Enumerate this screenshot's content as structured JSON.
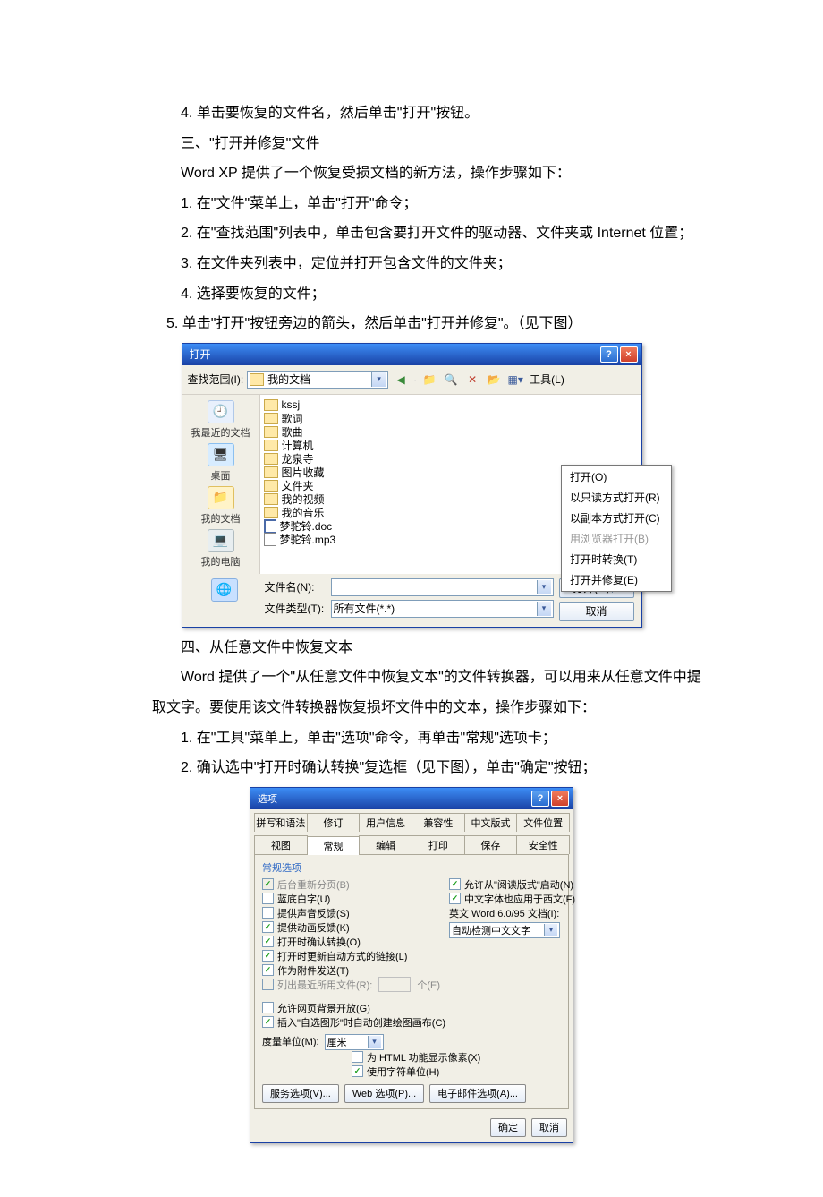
{
  "text": {
    "p1": "4. 单击要恢复的文件名，然后单击\"打开\"按钮。",
    "p2": "三、\"打开并修复\"文件",
    "p3": "Word XP 提供了一个恢复受损文档的新方法，操作步骤如下：",
    "p4": "1. 在\"文件\"菜单上，单击\"打开\"命令；",
    "p5": "2. 在\"查找范围\"列表中，单击包含要打开文件的驱动器、文件夹或 Internet 位置；",
    "p6": "3. 在文件夹列表中，定位并打开包含文件的文件夹；",
    "p7": "4. 选择要恢复的文件；",
    "p8": "5. 单击\"打开\"按钮旁边的箭头，然后单击\"打开并修复\"。（见下图）",
    "p9": "四、从任意文件中恢复文本",
    "p10": "Word 提供了一个\"从任意文件中恢复文本\"的文件转换器，可以用来从任意文件中提取文字。要使用该文件转换器恢复损坏文件中的文本，操作步骤如下：",
    "p11": "1. 在\"工具\"菜单上，单击\"选项\"命令，再单击\"常规\"选项卡；",
    "p12": "2. 确认选中\"打开时确认转换\"复选框（见下图），单击\"确定\"按钮；"
  },
  "dlg1": {
    "title": "打开",
    "lookInLabel": "查找范围(I):",
    "lookInValue": "我的文档",
    "toolsLabel": "工具(L)",
    "places": [
      {
        "label": "我最近的文档"
      },
      {
        "label": "桌面"
      },
      {
        "label": "我的文档"
      },
      {
        "label": "我的电脑"
      },
      {
        "label": ""
      }
    ],
    "files": [
      {
        "type": "f",
        "name": "kssj"
      },
      {
        "type": "f",
        "name": "歌词"
      },
      {
        "type": "f",
        "name": "歌曲"
      },
      {
        "type": "f",
        "name": "计算机"
      },
      {
        "type": "f",
        "name": "龙泉寺"
      },
      {
        "type": "f",
        "name": "图片收藏"
      },
      {
        "type": "f",
        "name": "文件夹"
      },
      {
        "type": "f",
        "name": "我的视频"
      },
      {
        "type": "f",
        "name": "我的音乐"
      },
      {
        "type": "d",
        "name": "梦驼铃.doc"
      },
      {
        "type": "m",
        "name": "梦驼铃.mp3"
      }
    ],
    "fileNameLabel": "文件名(N):",
    "fileTypeLabel": "文件类型(T):",
    "fileTypeValue": "所有文件(*.*)",
    "openBtn": "打开(O)",
    "cancelBtn": "取消",
    "menu": [
      {
        "t": "打开(O)",
        "dis": false
      },
      {
        "t": "以只读方式打开(R)",
        "dis": false
      },
      {
        "t": "以副本方式打开(C)",
        "dis": false
      },
      {
        "t": "用浏览器打开(B)",
        "dis": true
      },
      {
        "t": "打开时转换(T)",
        "dis": false
      },
      {
        "t": "打开并修复(E)",
        "dis": false
      }
    ]
  },
  "dlg2": {
    "title": "选项",
    "tabsRow1": [
      "拼写和语法",
      "修订",
      "用户信息",
      "兼容性",
      "中文版式",
      "文件位置"
    ],
    "tabsRow2": [
      "视图",
      "常规",
      "编辑",
      "打印",
      "保存",
      "安全性"
    ],
    "activeTab": "常规",
    "sectionLabel": "常规选项",
    "left": [
      {
        "label": "后台重新分页(B)",
        "checked": true,
        "disabled": true
      },
      {
        "label": "蓝底白字(U)",
        "checked": false
      },
      {
        "label": "提供声音反馈(S)",
        "checked": false
      },
      {
        "label": "提供动画反馈(K)",
        "checked": true
      },
      {
        "label": "打开时确认转换(O)",
        "checked": true
      },
      {
        "label": "打开时更新自动方式的链接(L)",
        "checked": true
      },
      {
        "label": "作为附件发送(T)",
        "checked": true
      }
    ],
    "recentLabel": "列出最近所用文件(R):",
    "recentUnit": "个(E)",
    "right": [
      {
        "label": "允许从\"阅读版式\"启动(N)",
        "checked": true
      },
      {
        "label": "中文字体也应用于西文(F)",
        "checked": true
      }
    ],
    "engLabel": "英文 Word 6.0/95 文档(I):",
    "engValue": "自动检测中文文字",
    "bottomChecks": [
      {
        "label": "允许网页背景开放(G)",
        "checked": false
      },
      {
        "label": "插入\"自选图形\"时自动创建绘图画布(C)",
        "checked": true
      }
    ],
    "unitLabel": "度量单位(M):",
    "unitValue": "厘米",
    "htmlPixel": {
      "label": "为 HTML 功能显示像素(X)",
      "checked": false
    },
    "charUnit": {
      "label": "使用字符单位(H)",
      "checked": true
    },
    "btns": [
      "服务选项(V)...",
      "Web 选项(P)...",
      "电子邮件选项(A)..."
    ],
    "ok": "确定",
    "cancel": "取消"
  }
}
